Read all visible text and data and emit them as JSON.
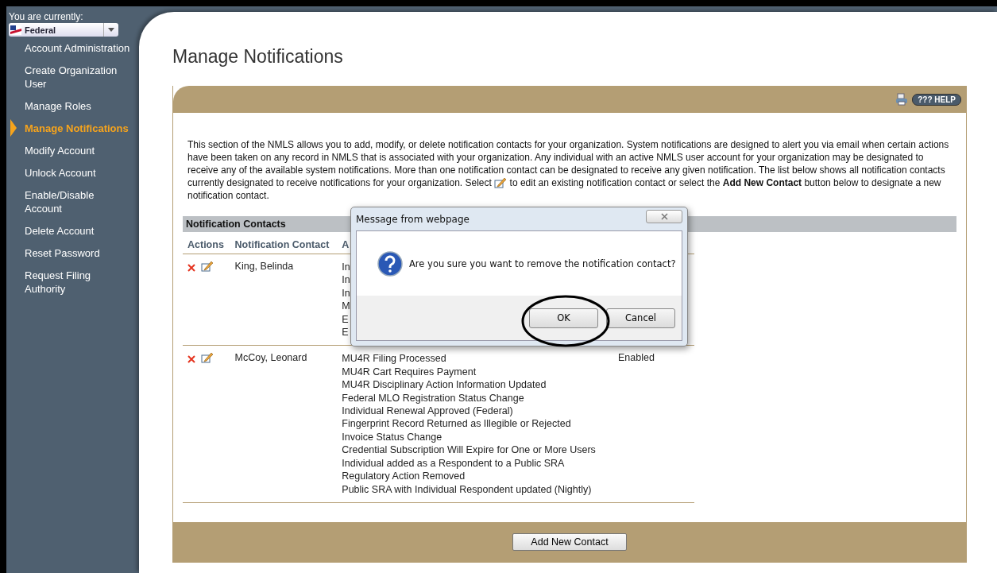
{
  "sidebar": {
    "jurisdiction_label": "You are currently:",
    "jurisdiction": "Federal",
    "items": [
      {
        "label": "Account Administration",
        "selected": false
      },
      {
        "label": "Create Organization User",
        "selected": false
      },
      {
        "label": "Manage Roles",
        "selected": false
      },
      {
        "label": "Manage Notifications",
        "selected": true
      },
      {
        "label": "Modify Account",
        "selected": false
      },
      {
        "label": "Unlock Account",
        "selected": false
      },
      {
        "label": "Enable/Disable Account",
        "selected": false
      },
      {
        "label": "Delete Account",
        "selected": false
      },
      {
        "label": "Reset Password",
        "selected": false
      },
      {
        "label": "Request Filing Authority",
        "selected": false
      }
    ]
  },
  "page_title": "Manage Notifications",
  "help_button": "??? HELP",
  "description_before": "This section of the NMLS allows you to add, modify, or delete notification contacts for your organization. System notifications are designed to alert you via email when certain actions have been taken on any record in NMLS that is associated with your organization. Any individual with an active NMLS user account for your organization may be designated to receive any of the available system notifications. More than one notification contact can be designated to receive any given notification. The list below shows all notification contacts currently designated to receive notifications for your organization. Select",
  "description_after": "to edit an existing notification contact or select the **Add New Contact** button below to designate a new notification contact.",
  "table": {
    "title": "Notification Contacts",
    "columns": [
      "Actions",
      "Notification Contact",
      "A"
    ],
    "rows": [
      {
        "name": "King, Belinda",
        "notifications": [
          "In",
          "In",
          "In",
          "M",
          "E",
          "E"
        ]
      },
      {
        "name": "McCoy, Leonard",
        "notifications": [
          "MU4R Filing Processed",
          "MU4R Cart Requires Payment",
          "MU4R Disciplinary Action Information Updated",
          "Federal MLO Registration Status Change",
          "Individual Renewal Approved (Federal)",
          "Fingerprint Record Returned as Illegible or Rejected",
          "Invoice Status Change",
          "Credential Subscription Will Expire for One or More Users",
          "Individual added as a Respondent to a Public SRA",
          "Regulatory Action Removed",
          "Public SRA with Individual Respondent updated (Nightly)"
        ],
        "status": "Enabled"
      }
    ]
  },
  "add_button": "Add New Contact",
  "dialog": {
    "title": "Message from webpage",
    "message": "Are you sure you want to remove the notification contact?",
    "buttons": [
      "OK",
      "Cancel"
    ]
  }
}
